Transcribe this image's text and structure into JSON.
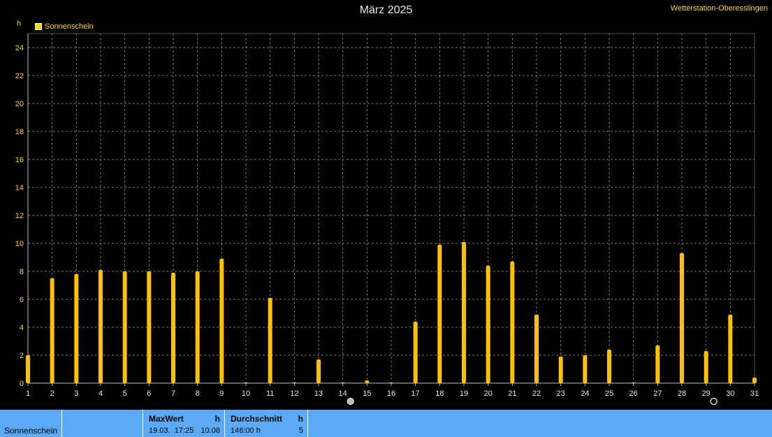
{
  "header": {
    "station": "Wetterstation-Oberesslingen"
  },
  "chart_data": {
    "type": "bar",
    "title": "März 2025",
    "ylabel": "h",
    "ylim": [
      0,
      25
    ],
    "yticks": [
      0,
      2,
      4,
      6,
      8,
      10,
      12,
      14,
      16,
      18,
      20,
      22,
      24
    ],
    "grid": true,
    "legend_position": "top-left",
    "categories": [
      "1",
      "2",
      "3",
      "4",
      "5",
      "6",
      "7",
      "8",
      "9",
      "10",
      "11",
      "12",
      "13",
      "14",
      "15",
      "16",
      "17",
      "18",
      "19",
      "20",
      "21",
      "22",
      "23",
      "24",
      "25",
      "26",
      "27",
      "28",
      "29",
      "30",
      "31"
    ],
    "series": [
      {
        "name": "Sonnenschein",
        "color": "#ffc000",
        "values": [
          2.0,
          7.5,
          7.8,
          8.1,
          8.0,
          8.0,
          7.9,
          8.0,
          8.9,
          0,
          6.1,
          0,
          1.7,
          0,
          0.2,
          0,
          4.4,
          9.9,
          10.1,
          8.4,
          8.7,
          4.9,
          1.9,
          2.0,
          2.4,
          0,
          2.7,
          9.3,
          2.3,
          4.9,
          0.4
        ]
      }
    ],
    "moon_markers": [
      {
        "day": "14",
        "icon": "full-moon-icon"
      },
      {
        "day": "29",
        "icon": "new-moon-icon"
      }
    ]
  },
  "footer": {
    "series_name": "Sonnenschein",
    "max": {
      "label": "MaxWert",
      "unit": "h",
      "date": "19.03.",
      "time": "17:25",
      "value": "10.08"
    },
    "avg": {
      "label": "Durchschnitt",
      "unit": "h",
      "total": "146:00 h",
      "value": "5"
    }
  }
}
